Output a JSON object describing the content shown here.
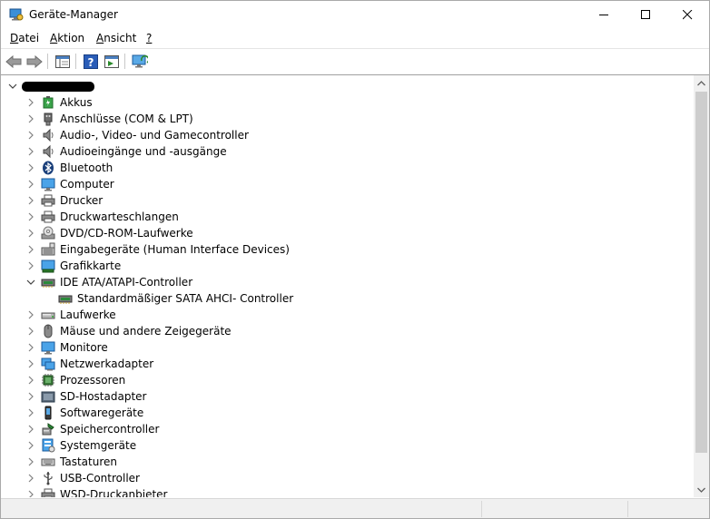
{
  "window": {
    "title": "Geräte-Manager"
  },
  "menu": [
    {
      "label_acc": "D",
      "label_rest": "atei"
    },
    {
      "label_acc": "A",
      "label_rest": "ktion"
    },
    {
      "label_acc": "A",
      "label_rest": "nsicht"
    },
    {
      "label_acc": "?",
      "label_rest": ""
    }
  ],
  "toolbar": {
    "buttons": [
      "back",
      "forward",
      "properties-view",
      "help",
      "show-hidden",
      "scan-hardware"
    ]
  },
  "tree": {
    "computer_name": "",
    "categories": [
      {
        "label": "Akkus",
        "icon": "battery-icon"
      },
      {
        "label": "Anschlüsse (COM & LPT)",
        "icon": "port-icon"
      },
      {
        "label": "Audio-, Video- und Gamecontroller",
        "icon": "speaker-icon"
      },
      {
        "label": "Audioeingänge und -ausgänge",
        "icon": "speaker-icon"
      },
      {
        "label": "Bluetooth",
        "icon": "bluetooth-icon"
      },
      {
        "label": "Computer",
        "icon": "monitor-icon"
      },
      {
        "label": "Drucker",
        "icon": "printer-icon"
      },
      {
        "label": "Druckwarteschlangen",
        "icon": "printer-icon"
      },
      {
        "label": "DVD/CD-ROM-Laufwerke",
        "icon": "disc-drive-icon"
      },
      {
        "label": "Eingabegeräte (Human Interface Devices)",
        "icon": "keyboard-hid-icon"
      },
      {
        "label": "Grafikkarte",
        "icon": "display-adapter-icon"
      },
      {
        "label": "IDE ATA/ATAPI-Controller",
        "icon": "ide-controller-icon",
        "expanded": true
      },
      {
        "label": "Standardmäßiger SATA AHCI- Controller",
        "icon": "ide-controller-icon",
        "child": true
      },
      {
        "label": "Laufwerke",
        "icon": "disk-drive-icon"
      },
      {
        "label": "Mäuse und andere Zeigegeräte",
        "icon": "mouse-icon"
      },
      {
        "label": "Monitore",
        "icon": "monitor-icon"
      },
      {
        "label": "Netzwerkadapter",
        "icon": "network-adapter-icon"
      },
      {
        "label": "Prozessoren",
        "icon": "processor-icon"
      },
      {
        "label": "SD-Hostadapter",
        "icon": "sd-host-icon"
      },
      {
        "label": "Softwaregeräte",
        "icon": "software-device-icon"
      },
      {
        "label": "Speichercontroller",
        "icon": "storage-controller-icon"
      },
      {
        "label": "Systemgeräte",
        "icon": "system-device-icon"
      },
      {
        "label": "Tastaturen",
        "icon": "keyboard-icon"
      },
      {
        "label": "USB-Controller",
        "icon": "usb-icon"
      },
      {
        "label": "WSD-Druckanbieter",
        "icon": "printer-icon"
      }
    ]
  },
  "status": {
    "text": ""
  },
  "colors": {
    "accent": "#1e6fc8",
    "tree_line": "#a0a0a0"
  }
}
